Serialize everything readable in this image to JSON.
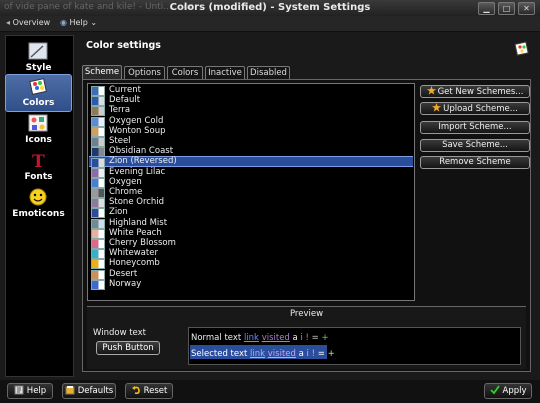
{
  "window": {
    "ghost_title": "of vide pane of kate and kile! - Unti... ...on",
    "title": "Colors (modified) - System Settings",
    "min_glyph": "▁",
    "max_glyph": "□",
    "close_glyph": "✕"
  },
  "toolbar": {
    "overview_label": "Overview",
    "help_label": "Help"
  },
  "sidebar": {
    "items": [
      {
        "label": "Style"
      },
      {
        "label": "Colors"
      },
      {
        "label": "Icons"
      },
      {
        "label": "Fonts"
      },
      {
        "label": "Emoticons"
      }
    ],
    "active_index": 1
  },
  "header": {
    "title": "Color settings"
  },
  "tabs": [
    {
      "label": "Scheme",
      "active": true
    },
    {
      "label": "Options"
    },
    {
      "label": "Colors"
    },
    {
      "label": "Inactive"
    },
    {
      "label": "Disabled"
    }
  ],
  "schemes": [
    "Current",
    "Default",
    "Terra",
    "Oxygen Cold",
    "Wonton Soup",
    "Steel",
    "Obsidian Coast",
    "Zion (Reversed)",
    "Evening Lilac",
    "Oxygen",
    "Chrome",
    "Stone Orchid",
    "Zion",
    "Highland Mist",
    "White Peach",
    "Cherry Blossom",
    "Whitewater",
    "Honeycomb",
    "Desert",
    "Norway"
  ],
  "selected_scheme_index": 7,
  "actions": {
    "get_new": "Get New Schemes...",
    "upload": "Upload Scheme...",
    "import": "Import Scheme...",
    "save": "Save Scheme...",
    "remove": "Remove Scheme"
  },
  "preview": {
    "title": "Preview",
    "window_text_label": "Window text",
    "push_button_label": "Push Button",
    "normal_text": "Normal text",
    "selected_text": "Selected text",
    "link": "link",
    "visited": "visited",
    "symbols_a": "a",
    "symbols_b": "i",
    "symbols_c": "!",
    "symbols_d": "=",
    "symbols_e": "+"
  },
  "footer": {
    "help": "Help",
    "defaults": "Defaults",
    "reset": "Reset",
    "apply": "Apply"
  },
  "colors": {
    "selection": "#2b4e9c",
    "link": "#6a8cff",
    "visited": "#b07ad0"
  }
}
